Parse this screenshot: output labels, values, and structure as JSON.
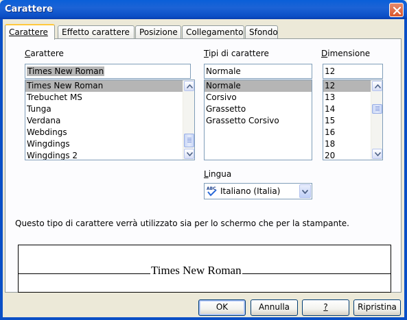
{
  "window": {
    "title": "Carattere"
  },
  "tabs": [
    {
      "label": "Carattere",
      "active": true
    },
    {
      "label": "Effetto carattere",
      "active": false
    },
    {
      "label": "Posizione",
      "active": false
    },
    {
      "label": "Collegamento",
      "active": false
    },
    {
      "label": "Sfondo",
      "active": false
    }
  ],
  "font": {
    "label": "Carattere",
    "value": "Times New Roman",
    "items": [
      "Times New Roman",
      "Trebuchet MS",
      "Tunga",
      "Verdana",
      "Webdings",
      "Wingdings",
      "Wingdings 2"
    ],
    "selected_index": 0
  },
  "style": {
    "label": "Tipi di carattere",
    "value": "Normale",
    "items": [
      "Normale",
      "Corsivo",
      "Grassetto",
      "Grassetto Corsivo"
    ],
    "selected_index": 0
  },
  "size": {
    "label": "Dimensione",
    "value": "12",
    "items": [
      "12",
      "13",
      "14",
      "15",
      "16",
      "18",
      "20"
    ],
    "selected_index": 0
  },
  "language": {
    "label": "Lingua",
    "value": "Italiano (Italia)",
    "icon": "spellcheck-abc-icon"
  },
  "info_text": "Questo tipo di carattere verrà utilizzato sia per lo schermo che per la stampante.",
  "preview": {
    "sample": "Times New Roman"
  },
  "buttons": {
    "ok": "OK",
    "cancel": "Annulla",
    "help": "?",
    "reset": "Ripristina"
  },
  "colors": {
    "title_bar": "#0A5FD8",
    "dialog_bg": "#ECE9D8",
    "selection": "#B5B5B5",
    "active_tab_accent": "#FFC83C"
  }
}
